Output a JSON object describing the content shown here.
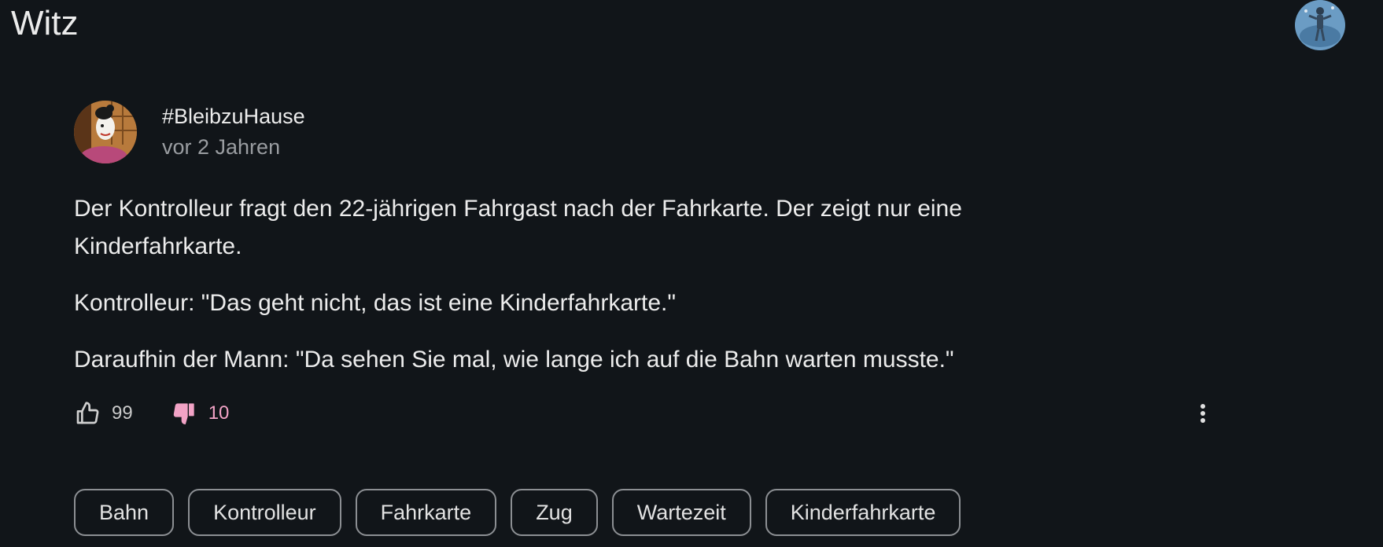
{
  "header": {
    "title": "Witz",
    "user_avatar_icon": "user-avatar-icon"
  },
  "post": {
    "author": "#BleibzuHause",
    "time": "vor 2 Jahren",
    "paragraphs": [
      "Der Kontrolleur fragt den 22-jährigen Fahrgast nach der Fahrkarte. Der zeigt nur eine Kinderfahrkarte.",
      "Kontrolleur: \"Das geht nicht, das ist eine Kinderfahrkarte.\"",
      "Daraufhin der Mann: \"Da sehen Sie mal, wie lange ich auf die Bahn warten musste.\""
    ],
    "likes": "99",
    "dislikes": "10",
    "more_icon": "more-vertical-icon"
  },
  "tags": [
    "Bahn",
    "Kontrolleur",
    "Fahrkarte",
    "Zug",
    "Wartezeit",
    "Kinderfahrkarte"
  ],
  "colors": {
    "background": "#111519",
    "text": "#ececec",
    "muted": "#9a9da1",
    "dislike_accent": "#f2a3c6",
    "tag_border": "#8c8f93"
  }
}
